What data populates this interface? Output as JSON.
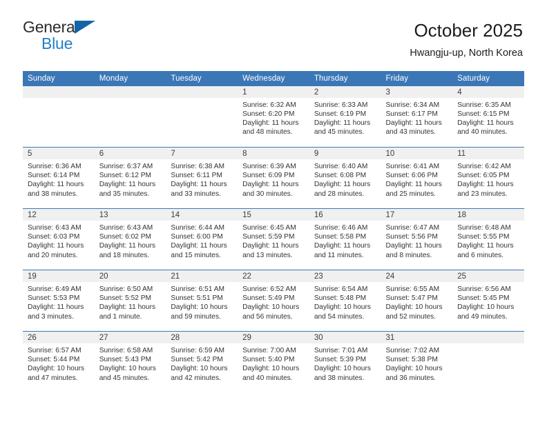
{
  "brand": {
    "name_part1": "General",
    "name_part2": "Blue",
    "accent_color": "#1f7fc4",
    "header_color": "#3b77b6"
  },
  "header": {
    "title": "October 2025",
    "subtitle": "Hwangju-up, North Korea"
  },
  "weekday_headers": [
    "Sunday",
    "Monday",
    "Tuesday",
    "Wednesday",
    "Thursday",
    "Friday",
    "Saturday"
  ],
  "weeks": [
    [
      {
        "day": "",
        "sunrise": "",
        "sunset": "",
        "daylight": "",
        "daylight2": ""
      },
      {
        "day": "",
        "sunrise": "",
        "sunset": "",
        "daylight": "",
        "daylight2": ""
      },
      {
        "day": "",
        "sunrise": "",
        "sunset": "",
        "daylight": "",
        "daylight2": ""
      },
      {
        "day": "1",
        "sunrise": "Sunrise: 6:32 AM",
        "sunset": "Sunset: 6:20 PM",
        "daylight": "Daylight: 11 hours",
        "daylight2": "and 48 minutes."
      },
      {
        "day": "2",
        "sunrise": "Sunrise: 6:33 AM",
        "sunset": "Sunset: 6:19 PM",
        "daylight": "Daylight: 11 hours",
        "daylight2": "and 45 minutes."
      },
      {
        "day": "3",
        "sunrise": "Sunrise: 6:34 AM",
        "sunset": "Sunset: 6:17 PM",
        "daylight": "Daylight: 11 hours",
        "daylight2": "and 43 minutes."
      },
      {
        "day": "4",
        "sunrise": "Sunrise: 6:35 AM",
        "sunset": "Sunset: 6:15 PM",
        "daylight": "Daylight: 11 hours",
        "daylight2": "and 40 minutes."
      }
    ],
    [
      {
        "day": "5",
        "sunrise": "Sunrise: 6:36 AM",
        "sunset": "Sunset: 6:14 PM",
        "daylight": "Daylight: 11 hours",
        "daylight2": "and 38 minutes."
      },
      {
        "day": "6",
        "sunrise": "Sunrise: 6:37 AM",
        "sunset": "Sunset: 6:12 PM",
        "daylight": "Daylight: 11 hours",
        "daylight2": "and 35 minutes."
      },
      {
        "day": "7",
        "sunrise": "Sunrise: 6:38 AM",
        "sunset": "Sunset: 6:11 PM",
        "daylight": "Daylight: 11 hours",
        "daylight2": "and 33 minutes."
      },
      {
        "day": "8",
        "sunrise": "Sunrise: 6:39 AM",
        "sunset": "Sunset: 6:09 PM",
        "daylight": "Daylight: 11 hours",
        "daylight2": "and 30 minutes."
      },
      {
        "day": "9",
        "sunrise": "Sunrise: 6:40 AM",
        "sunset": "Sunset: 6:08 PM",
        "daylight": "Daylight: 11 hours",
        "daylight2": "and 28 minutes."
      },
      {
        "day": "10",
        "sunrise": "Sunrise: 6:41 AM",
        "sunset": "Sunset: 6:06 PM",
        "daylight": "Daylight: 11 hours",
        "daylight2": "and 25 minutes."
      },
      {
        "day": "11",
        "sunrise": "Sunrise: 6:42 AM",
        "sunset": "Sunset: 6:05 PM",
        "daylight": "Daylight: 11 hours",
        "daylight2": "and 23 minutes."
      }
    ],
    [
      {
        "day": "12",
        "sunrise": "Sunrise: 6:43 AM",
        "sunset": "Sunset: 6:03 PM",
        "daylight": "Daylight: 11 hours",
        "daylight2": "and 20 minutes."
      },
      {
        "day": "13",
        "sunrise": "Sunrise: 6:43 AM",
        "sunset": "Sunset: 6:02 PM",
        "daylight": "Daylight: 11 hours",
        "daylight2": "and 18 minutes."
      },
      {
        "day": "14",
        "sunrise": "Sunrise: 6:44 AM",
        "sunset": "Sunset: 6:00 PM",
        "daylight": "Daylight: 11 hours",
        "daylight2": "and 15 minutes."
      },
      {
        "day": "15",
        "sunrise": "Sunrise: 6:45 AM",
        "sunset": "Sunset: 5:59 PM",
        "daylight": "Daylight: 11 hours",
        "daylight2": "and 13 minutes."
      },
      {
        "day": "16",
        "sunrise": "Sunrise: 6:46 AM",
        "sunset": "Sunset: 5:58 PM",
        "daylight": "Daylight: 11 hours",
        "daylight2": "and 11 minutes."
      },
      {
        "day": "17",
        "sunrise": "Sunrise: 6:47 AM",
        "sunset": "Sunset: 5:56 PM",
        "daylight": "Daylight: 11 hours",
        "daylight2": "and 8 minutes."
      },
      {
        "day": "18",
        "sunrise": "Sunrise: 6:48 AM",
        "sunset": "Sunset: 5:55 PM",
        "daylight": "Daylight: 11 hours",
        "daylight2": "and 6 minutes."
      }
    ],
    [
      {
        "day": "19",
        "sunrise": "Sunrise: 6:49 AM",
        "sunset": "Sunset: 5:53 PM",
        "daylight": "Daylight: 11 hours",
        "daylight2": "and 3 minutes."
      },
      {
        "day": "20",
        "sunrise": "Sunrise: 6:50 AM",
        "sunset": "Sunset: 5:52 PM",
        "daylight": "Daylight: 11 hours",
        "daylight2": "and 1 minute."
      },
      {
        "day": "21",
        "sunrise": "Sunrise: 6:51 AM",
        "sunset": "Sunset: 5:51 PM",
        "daylight": "Daylight: 10 hours",
        "daylight2": "and 59 minutes."
      },
      {
        "day": "22",
        "sunrise": "Sunrise: 6:52 AM",
        "sunset": "Sunset: 5:49 PM",
        "daylight": "Daylight: 10 hours",
        "daylight2": "and 56 minutes."
      },
      {
        "day": "23",
        "sunrise": "Sunrise: 6:54 AM",
        "sunset": "Sunset: 5:48 PM",
        "daylight": "Daylight: 10 hours",
        "daylight2": "and 54 minutes."
      },
      {
        "day": "24",
        "sunrise": "Sunrise: 6:55 AM",
        "sunset": "Sunset: 5:47 PM",
        "daylight": "Daylight: 10 hours",
        "daylight2": "and 52 minutes."
      },
      {
        "day": "25",
        "sunrise": "Sunrise: 6:56 AM",
        "sunset": "Sunset: 5:45 PM",
        "daylight": "Daylight: 10 hours",
        "daylight2": "and 49 minutes."
      }
    ],
    [
      {
        "day": "26",
        "sunrise": "Sunrise: 6:57 AM",
        "sunset": "Sunset: 5:44 PM",
        "daylight": "Daylight: 10 hours",
        "daylight2": "and 47 minutes."
      },
      {
        "day": "27",
        "sunrise": "Sunrise: 6:58 AM",
        "sunset": "Sunset: 5:43 PM",
        "daylight": "Daylight: 10 hours",
        "daylight2": "and 45 minutes."
      },
      {
        "day": "28",
        "sunrise": "Sunrise: 6:59 AM",
        "sunset": "Sunset: 5:42 PM",
        "daylight": "Daylight: 10 hours",
        "daylight2": "and 42 minutes."
      },
      {
        "day": "29",
        "sunrise": "Sunrise: 7:00 AM",
        "sunset": "Sunset: 5:40 PM",
        "daylight": "Daylight: 10 hours",
        "daylight2": "and 40 minutes."
      },
      {
        "day": "30",
        "sunrise": "Sunrise: 7:01 AM",
        "sunset": "Sunset: 5:39 PM",
        "daylight": "Daylight: 10 hours",
        "daylight2": "and 38 minutes."
      },
      {
        "day": "31",
        "sunrise": "Sunrise: 7:02 AM",
        "sunset": "Sunset: 5:38 PM",
        "daylight": "Daylight: 10 hours",
        "daylight2": "and 36 minutes."
      },
      {
        "day": "",
        "sunrise": "",
        "sunset": "",
        "daylight": "",
        "daylight2": ""
      }
    ]
  ]
}
